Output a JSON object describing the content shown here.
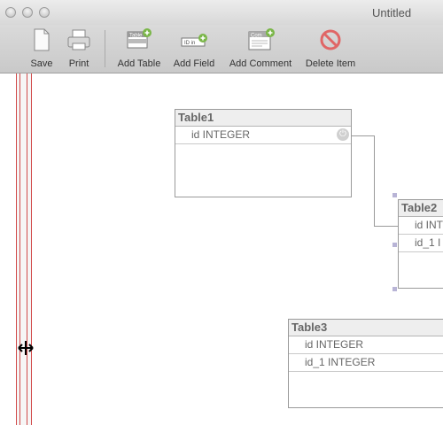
{
  "window": {
    "title": "Untitled"
  },
  "toolbar": {
    "save": "Save",
    "print": "Print",
    "add_table": "Add Table",
    "add_field": "Add Field",
    "add_comment": "Add Comment",
    "delete_item": "Delete Item",
    "add_table_icon_text": "Table",
    "add_field_icon_text": "ID in",
    "add_comment_icon_text": "Com"
  },
  "tables": [
    {
      "name": "Table1",
      "rows": [
        "id INTEGER"
      ]
    },
    {
      "name": "Table2",
      "rows": [
        "id INT",
        "id_1 I"
      ]
    },
    {
      "name": "Table3",
      "rows": [
        "id INTEGER",
        "id_1 INTEGER"
      ]
    }
  ],
  "colors": {
    "accent": "#d24a4a",
    "selection_handle": "#b8b4d6"
  },
  "icons": [
    "save-icon",
    "print-icon",
    "add-table-icon",
    "add-field-icon",
    "add-comment-icon",
    "delete-icon",
    "resize-cursor-icon",
    "primary-key-icon"
  ]
}
